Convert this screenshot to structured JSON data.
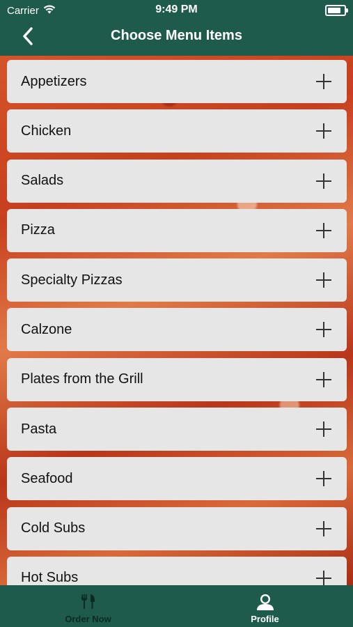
{
  "status_bar": {
    "carrier": "Carrier",
    "time": "9:49 PM",
    "battery_level": 1.0,
    "wifi_icon": "wifi-icon",
    "battery_icon": "battery-icon"
  },
  "nav": {
    "title": "Choose Menu Items",
    "back_icon": "chevron-left-icon"
  },
  "menu": {
    "items": [
      {
        "label": "Appetizers"
      },
      {
        "label": "Chicken"
      },
      {
        "label": "Salads"
      },
      {
        "label": "Pizza"
      },
      {
        "label": "Specialty Pizzas"
      },
      {
        "label": "Calzone"
      },
      {
        "label": "Plates from the Grill"
      },
      {
        "label": "Pasta"
      },
      {
        "label": "Seafood"
      },
      {
        "label": "Cold Subs"
      },
      {
        "label": "Hot Subs"
      }
    ],
    "expand_icon": "plus-icon"
  },
  "tab_bar": {
    "tabs": [
      {
        "label": "Order Now",
        "icon": "utensils-icon",
        "selected": false
      },
      {
        "label": "Profile",
        "icon": "user-icon",
        "selected": true
      }
    ]
  },
  "colors": {
    "brand_green": "#1f5b4d",
    "item_background": "#e6e6e6",
    "tab_inactive": "#0c2a22",
    "tab_active": "#ffffff"
  }
}
